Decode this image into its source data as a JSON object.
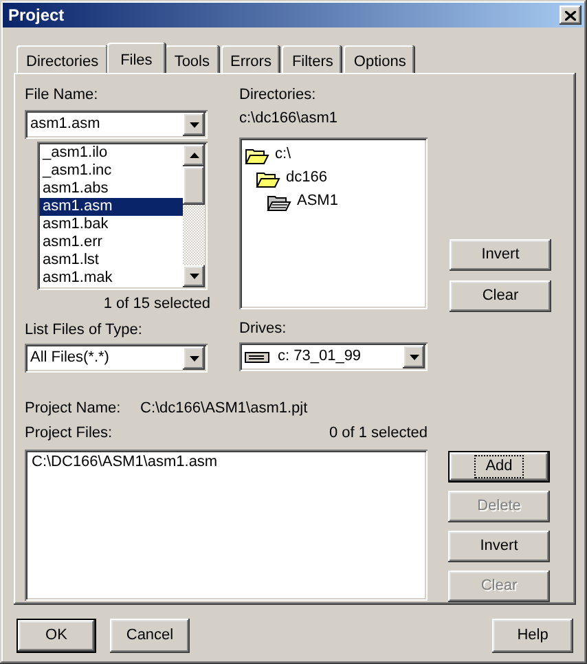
{
  "window": {
    "title": "Project"
  },
  "tabs": [
    {
      "label": "Directories",
      "selected": false
    },
    {
      "label": "Files",
      "selected": true
    },
    {
      "label": "Tools",
      "selected": false
    },
    {
      "label": "Errors",
      "selected": false
    },
    {
      "label": "Filters",
      "selected": false
    },
    {
      "label": "Options",
      "selected": false
    }
  ],
  "file_name": {
    "label": "File Name:",
    "value": "asm1.asm"
  },
  "file_list": {
    "items": [
      {
        "text": "_asm1.ilo",
        "selected": false
      },
      {
        "text": "_asm1.inc",
        "selected": false
      },
      {
        "text": "asm1.abs",
        "selected": false
      },
      {
        "text": "asm1.asm",
        "selected": true
      },
      {
        "text": "asm1.bak",
        "selected": false
      },
      {
        "text": "asm1.err",
        "selected": false
      },
      {
        "text": "asm1.lst",
        "selected": false
      },
      {
        "text": "asm1.mak",
        "selected": false
      }
    ],
    "status": "1 of 15 selected"
  },
  "file_type": {
    "label": "List Files of Type:",
    "value": "All Files(*.*)"
  },
  "directories": {
    "label": "Directories:",
    "path": "c:\\dc166\\asm1",
    "tree": [
      {
        "name": "c:\\",
        "selected": false,
        "children": [
          {
            "name": "dc166",
            "selected": false,
            "children": [
              {
                "name": "ASM1",
                "selected": true
              }
            ]
          }
        ]
      }
    ]
  },
  "drives": {
    "label": "Drives:",
    "value": "c: 73_01_99"
  },
  "directory_buttons": [
    {
      "label": "Invert",
      "disabled": false
    },
    {
      "label": "Clear",
      "disabled": false
    }
  ],
  "project_name": {
    "label": "Project Name:",
    "value": "C:\\dc166\\ASM1\\asm1.pjt"
  },
  "project_files": {
    "label": "Project Files:",
    "status": "0 of 1 selected",
    "items": [
      {
        "text": "C:\\DC166\\ASM1\\asm1.asm",
        "selected": false
      }
    ]
  },
  "project_buttons": [
    {
      "label": "Add",
      "disabled": false,
      "default": true
    },
    {
      "label": "Delete",
      "disabled": true,
      "default": false
    },
    {
      "label": "Invert",
      "disabled": false,
      "default": false
    },
    {
      "label": "Clear",
      "disabled": true,
      "default": false
    }
  ],
  "footer_buttons": [
    {
      "label": "OK",
      "disabled": false,
      "default": true
    },
    {
      "label": "Cancel",
      "disabled": false,
      "default": false
    }
  ],
  "help_button": {
    "label": "Help",
    "disabled": false,
    "default": false
  }
}
